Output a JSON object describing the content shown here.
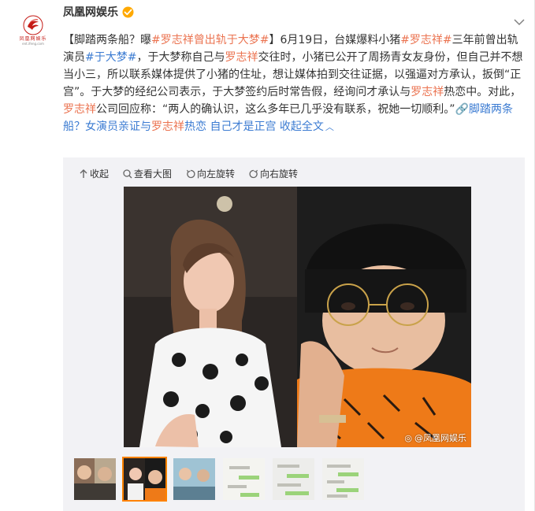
{
  "author": {
    "name": "凤凰网娱乐",
    "avatar_logo_text": "凤凰网娱乐",
    "avatar_logo_sub": "ent.ifeng.com"
  },
  "post": {
    "seg1": "【脚踏两条船？曝",
    "tag1": "#罗志祥曾出轨于大梦#",
    "seg2": "】6月19日，台媒爆料小猪",
    "tag2": "#罗志祥#",
    "seg3": "三年前曾出轨演员",
    "tag3": "#于大梦#",
    "seg4": "，于大梦称自己与",
    "name1": "罗志祥",
    "seg5": "交往时，小猪已公开了周扬青女友身份，但自己并不想当小三，所以联系媒体提供了小猪的住址，想让媒体拍到交往证据，以强逼对方承认，扳倒“正宫”。于大梦的经纪公司表示，于大梦签约后时常告假，经询问才承认与",
    "name2": "罗志祥",
    "seg6": "热恋中。对此，",
    "name3": "罗志祥",
    "seg7": "公司回应称：“两人的确认识，这么多年已几乎没有联系，祝她一切顺利。”",
    "link_title": "脚踏两条船？女演员亲证与",
    "link_name": "罗志祥",
    "link_title_end": "热恋 自己才是正宫",
    "collapse_label": "收起全文"
  },
  "toolbar": {
    "collapse": "收起",
    "view_large": "查看大图",
    "rotate_left": "向左旋转",
    "rotate_right": "向右旋转"
  },
  "image": {
    "watermark": "@凤凰网娱乐"
  },
  "thumbnails": {
    "count": 6,
    "active_index": 1
  },
  "colors": {
    "link": "#eb7350",
    "blue_link": "#3b7bd2",
    "active_thumb_border": "#ff8200",
    "verified": "#ffa900"
  }
}
